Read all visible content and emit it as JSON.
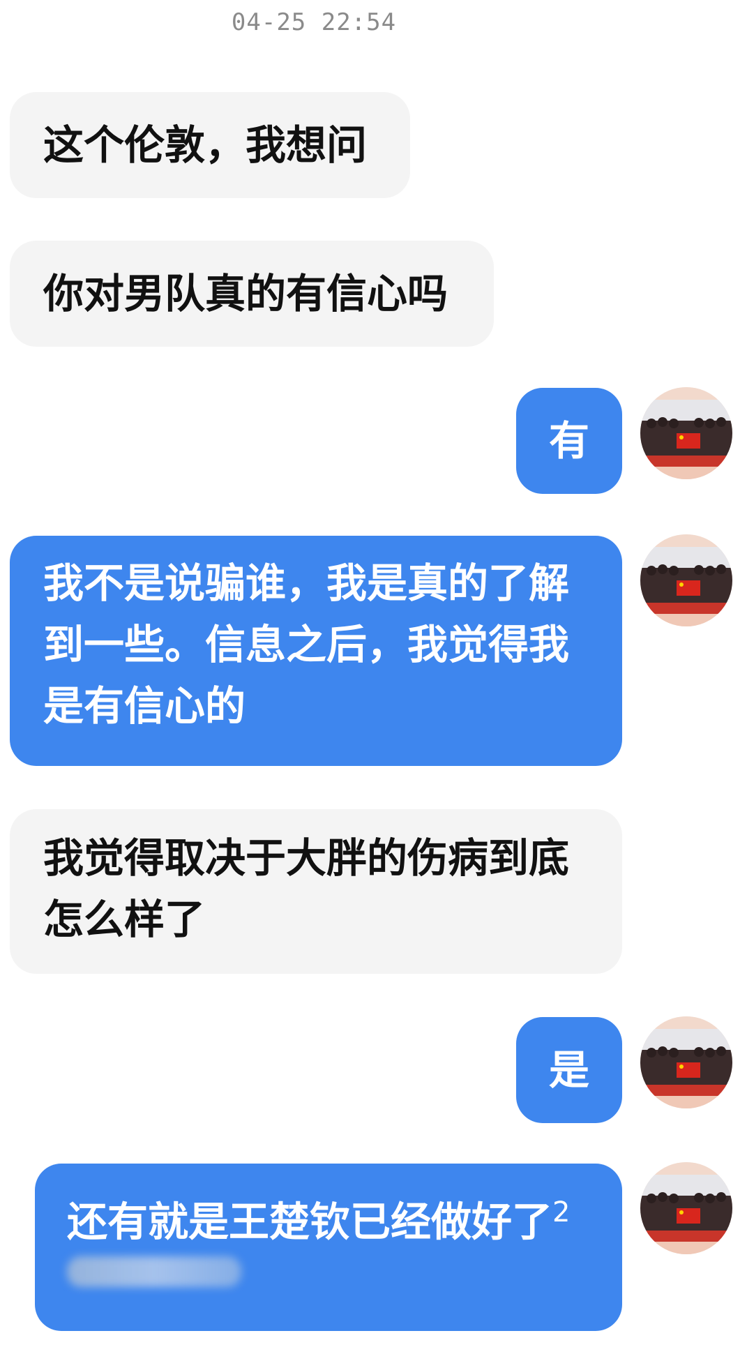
{
  "chat": {
    "timestamp": "04-25 22:54",
    "messages": [
      {
        "side": "received",
        "text": "这个伦敦，我想问"
      },
      {
        "side": "received",
        "text": "你对男队真的有信心吗"
      },
      {
        "side": "sent",
        "text": "有"
      },
      {
        "side": "sent",
        "text": "我不是说骗谁，我是真的了解到一些。信息之后，我觉得我是有信心的"
      },
      {
        "side": "received",
        "text": "我觉得取决于大胖的伤病到底怎么样了"
      },
      {
        "side": "sent",
        "text": "是"
      },
      {
        "side": "sent",
        "text": "还有就是王楚钦已经做好了",
        "suffix": "2"
      }
    ]
  },
  "avatar": {
    "icon": "team-photo-avatar-icon",
    "colors": {
      "ring": "#f2d9cc",
      "flag": "#d8261d",
      "star": "#ffd400"
    }
  },
  "theme": {
    "sent_bubble": "#3e86ee",
    "received_bubble": "#f4f4f4"
  }
}
